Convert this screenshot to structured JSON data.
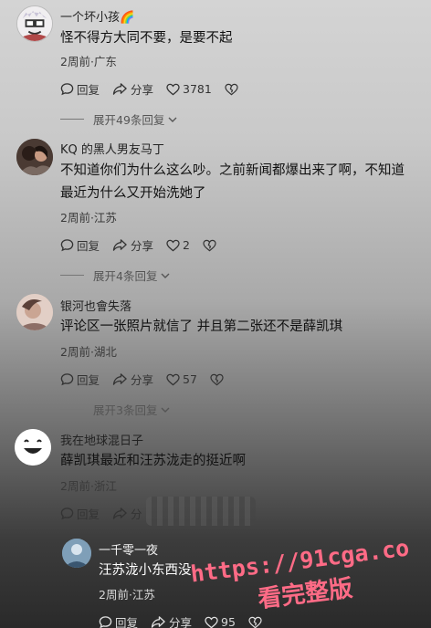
{
  "comments": [
    {
      "username": "一个坏小孩🌈",
      "text": "怪不得方大同不要，是要不起",
      "meta": "2周前·广东",
      "reply_label": "回复",
      "share_label": "分享",
      "likes": "3781",
      "expand_label": "展开49条回复"
    },
    {
      "username": "KQ 的黑人男友马丁",
      "text_line1": "不知道你们为什么这么吵。之前新闻都爆出来了啊，不知道",
      "text_line2": "最近为什么又开始洗她了",
      "meta": "2周前·江苏",
      "reply_label": "回复",
      "share_label": "分享",
      "likes": "2",
      "expand_label": "展开4条回复"
    },
    {
      "username": "银河也會失落",
      "text": "评论区一张照片就信了 并且第二张还不是薛凯琪",
      "meta": "2周前·湖北",
      "reply_label": "回复",
      "share_label": "分享",
      "likes": "57",
      "expand_label": "展开3条回复"
    },
    {
      "username": "我在地球混日子",
      "text": "薛凯琪最近和汪苏泷走的挺近啊",
      "meta": "2周前·浙江",
      "reply_label": "回复",
      "share_label": "分"
    },
    {
      "username": "一千零一夜",
      "text": "汪苏泷小东西没",
      "meta": "2周前·江苏",
      "reply_label": "回复",
      "share_label": "分享",
      "likes": "95"
    }
  ],
  "watermark": {
    "line1": "https://91cga.co",
    "line2": "看完整版"
  },
  "colors": {
    "watermark": "#ff6b86"
  }
}
